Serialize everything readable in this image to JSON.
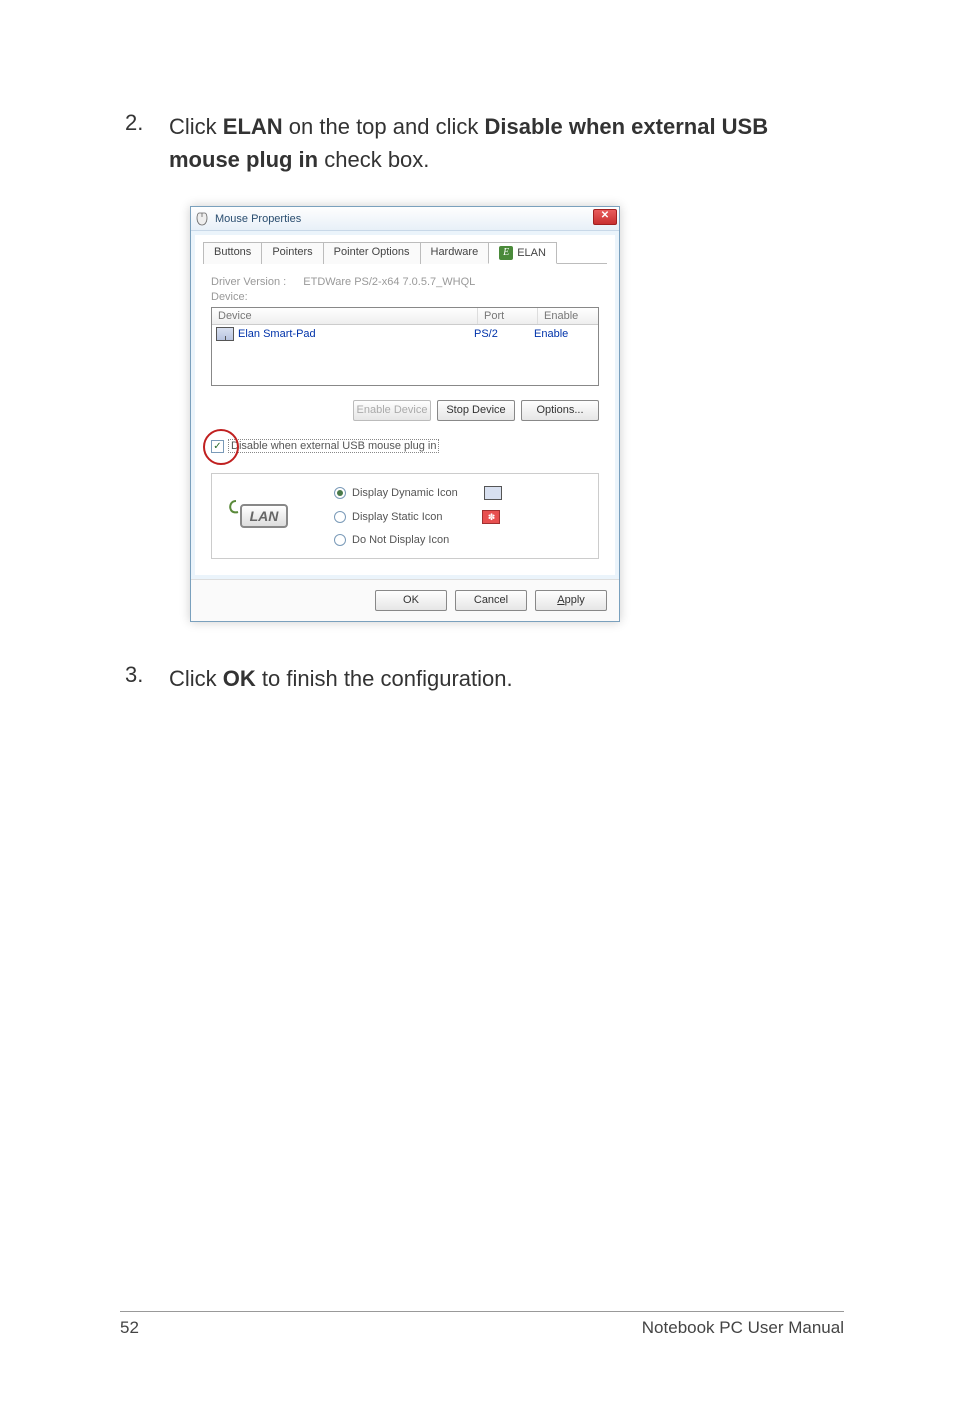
{
  "steps": {
    "s2": {
      "num": "2.",
      "pre": "Click ",
      "b1": "ELAN",
      "mid": " on the top and click ",
      "b2": "Disable when external USB mouse plug in",
      "post": " check box."
    },
    "s3": {
      "num": "3.",
      "pre": "Click ",
      "b1": "OK",
      "post": " to finish the configuration."
    }
  },
  "dialog": {
    "title": "Mouse Properties",
    "tabs": {
      "buttons": "Buttons",
      "pointers": "Pointers",
      "pointer_options": "Pointer Options",
      "hardware": "Hardware",
      "elan": "ELAN"
    },
    "driver_version_label": "Driver Version :",
    "driver_version_value": "ETDWare PS/2-x64 7.0.5.7_WHQL",
    "device_label": "Device:",
    "table": {
      "h_device": "Device",
      "h_port": "Port",
      "h_enable": "Enable",
      "row": {
        "name": "Elan Smart-Pad",
        "port": "PS/2",
        "enable": "Enable"
      }
    },
    "buttons_row": {
      "enable": "Enable Device",
      "stop": "Stop Device",
      "options": "Options..."
    },
    "checkbox_label": "Disable when external USB mouse plug in",
    "logo_text": "LAN",
    "radios": {
      "dynamic": "Display Dynamic Icon",
      "static_": "Display Static Icon",
      "none": "Do Not Display Icon"
    },
    "dlg_buttons": {
      "ok": "OK",
      "cancel": "Cancel",
      "apply_pre": "",
      "apply_u": "A",
      "apply_post": "pply"
    }
  },
  "footer": {
    "page": "52",
    "manual": "Notebook PC User Manual"
  }
}
